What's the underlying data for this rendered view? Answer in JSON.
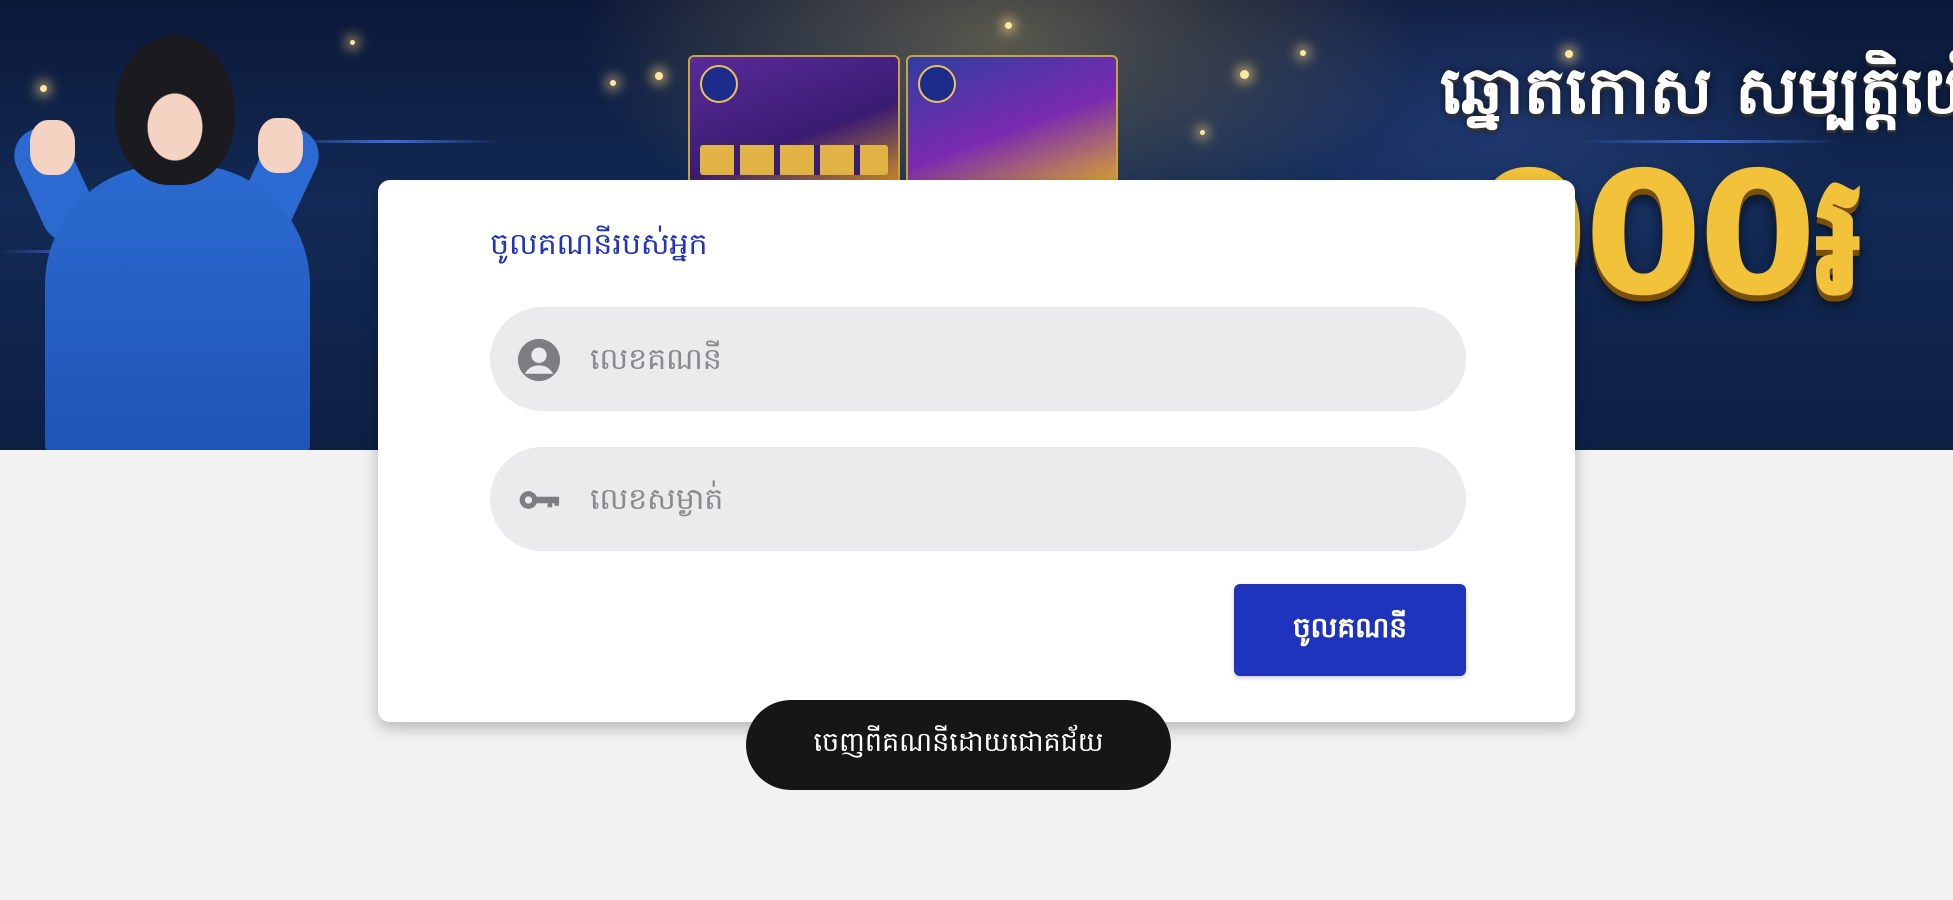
{
  "banner": {
    "promo_title": "ឆ្នោតកោស សម្បត្តិយើង",
    "promo_amount": "000៛"
  },
  "login": {
    "title": "ចូលគណនីរបស់អ្នក",
    "username_placeholder": "លេខគណនី",
    "username_value": "",
    "password_placeholder": "លេខសម្ងាត់",
    "password_value": "",
    "submit_label": "ចូលគណនី"
  },
  "icons": {
    "username": "account-circle-icon",
    "password": "key-icon"
  },
  "colors": {
    "accent": "#1e34bd",
    "title": "#2235b9",
    "toast_bg": "#161616",
    "field_bg": "#ebebed",
    "page_bg": "#f2f2f3"
  },
  "toast": {
    "message": "ចេញពីគណនីដោយជោគជ័យ"
  }
}
